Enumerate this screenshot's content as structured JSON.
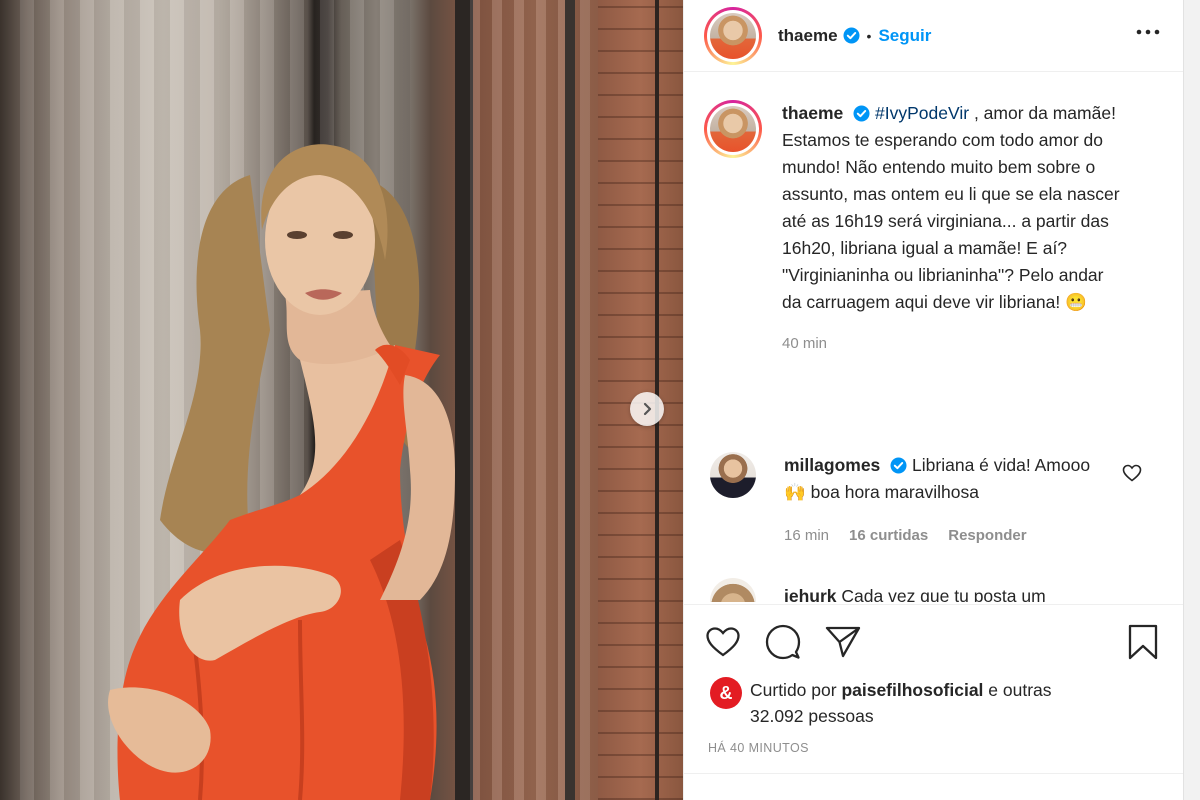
{
  "post": {
    "username": "thaeme",
    "follow_label": "Seguir",
    "separator": "•",
    "more_icon": "more-horizontal-icon"
  },
  "caption": {
    "username": "thaeme",
    "hashtag": "#IvyPodeVir",
    "text": " , amor da mamãe! Estamos te esperando com todo amor do mundo! Não entendo muito bem sobre o assunto, mas ontem eu li que se ela nascer até as 16h19 será virginiana... a partir das 16h20, libriana igual a mamãe! E aí? \"Virginianinha ou librianinha\"? Pelo andar da carruagem aqui deve vir libriana! 😬",
    "time": "40 min"
  },
  "comments": [
    {
      "username": "millagomes",
      "text": " Libriana é vida! Amooo 🙌 boa hora maravilhosa",
      "time": "16 min",
      "likes": "16 curtidas",
      "reply_label": "Responder"
    },
    {
      "username": "iehurk",
      "text": " Cada vez que tu posta um"
    }
  ],
  "likes": {
    "prefix": "Curtido por ",
    "by": "paisefilhosoficial",
    "suffix": " e outras 32.092 pessoas",
    "logo": "&"
  },
  "timeago": "HÁ 40 MINUTOS",
  "colors": {
    "link_blue": "#0095f6",
    "hashtag": "#00376b",
    "muted": "#8e8e8e",
    "dress_orange": "#e8522b"
  }
}
